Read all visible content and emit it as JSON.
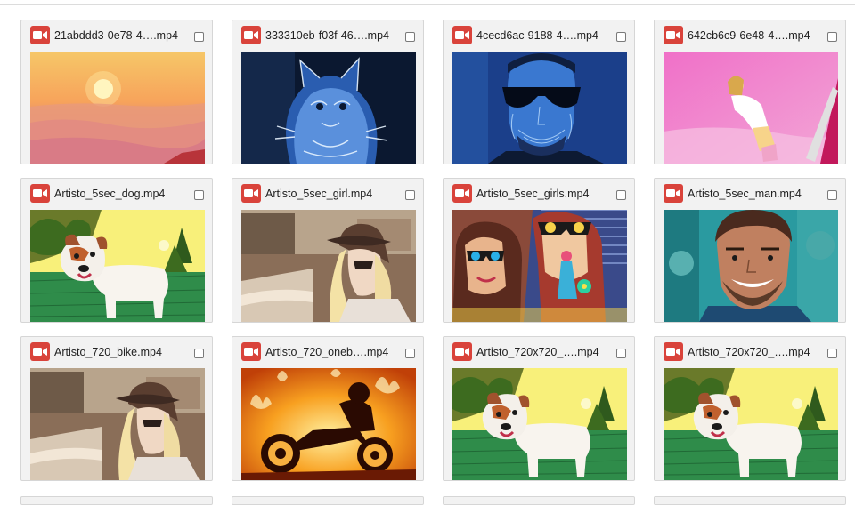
{
  "videos": [
    {
      "name": "21abddd3-0e78-4….mp4",
      "scene": "sunset"
    },
    {
      "name": "333310eb-f03f-46….mp4",
      "scene": "neon-cat"
    },
    {
      "name": "4cecd6ac-9188-4….mp4",
      "scene": "neon-man"
    },
    {
      "name": "642cb6c9-6e48-4….mp4",
      "scene": "pink-girl"
    },
    {
      "name": "Artisto_5sec_dog.mp4",
      "scene": "dog"
    },
    {
      "name": "Artisto_5sec_girl.mp4",
      "scene": "girl-car"
    },
    {
      "name": "Artisto_5sec_girls.mp4",
      "scene": "girls"
    },
    {
      "name": "Artisto_5sec_man.mp4",
      "scene": "man"
    },
    {
      "name": "Artisto_720_bike.mp4",
      "scene": "girl-car"
    },
    {
      "name": "Artisto_720_oneb….mp4",
      "scene": "fire-bike"
    },
    {
      "name": "Artisto_720x720_….mp4",
      "scene": "dog"
    },
    {
      "name": "Artisto_720x720_….mp4",
      "scene": "dog"
    }
  ],
  "icons": {
    "file_type": "video-camera-icon",
    "select": "checkbox"
  },
  "colors": {
    "icon_bg": "#d9433b",
    "card_bg": "#f2f2f2",
    "card_border": "#d6d6d6"
  }
}
